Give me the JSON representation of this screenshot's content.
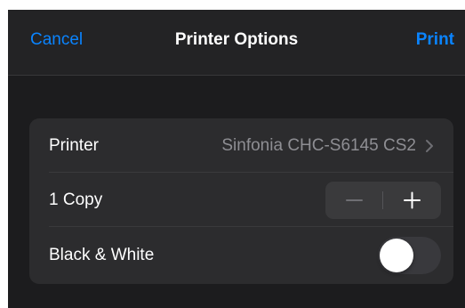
{
  "navbar": {
    "cancel_label": "Cancel",
    "title": "Printer Options",
    "print_label": "Print"
  },
  "options": {
    "printer": {
      "label": "Printer",
      "value": "Sinfonia CHC-S6145 CS2",
      "icon": "chevron-right-icon"
    },
    "copies": {
      "label": "1 Copy",
      "count": 1,
      "decrement_icon": "minus-icon",
      "increment_icon": "plus-icon",
      "decrement_enabled": false
    },
    "black_white": {
      "label": "Black & White",
      "enabled": false
    }
  },
  "colors": {
    "accent": "#0a84ff",
    "background": "#1c1c1e",
    "group_background": "#2c2c2e",
    "secondary_text": "#8e8e93"
  }
}
